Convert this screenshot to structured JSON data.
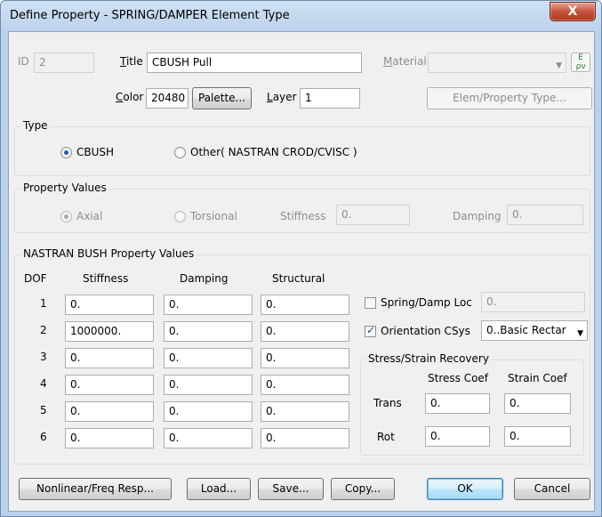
{
  "window": {
    "title": "Define Property - SPRING/DAMPER Element Type",
    "close_label": "X"
  },
  "header": {
    "id_label": "ID",
    "id_value": "2",
    "title_label": "Title",
    "title_value": "CBUSH Pull",
    "material_label": "Material",
    "material_value": "",
    "color_label": "Color",
    "color_value": "20480",
    "palette_label": "Palette...",
    "layer_label": "Layer",
    "layer_value": "1",
    "elem_prop_label": "Elem/Property Type..."
  },
  "type_group": {
    "title": "Type",
    "options": [
      {
        "label": "CBUSH",
        "checked": true
      },
      {
        "label": "Other( NASTRAN CROD/CVISC )",
        "checked": false
      }
    ]
  },
  "property_values": {
    "title": "Property Values",
    "axial_label": "Axial",
    "torsional_label": "Torsional",
    "stiffness_label": "Stiffness",
    "stiffness_value": "0.",
    "damping_label": "Damping",
    "damping_value": "0."
  },
  "bush": {
    "title": "NASTRAN BUSH Property Values",
    "headers": {
      "dof": "DOF",
      "stiffness": "Stiffness",
      "damping": "Damping",
      "structural": "Structural"
    },
    "rows": [
      {
        "dof": "1",
        "stiffness": "0.",
        "damping": "0.",
        "structural": "0."
      },
      {
        "dof": "2",
        "stiffness": "1000000.",
        "damping": "0.",
        "structural": "0."
      },
      {
        "dof": "3",
        "stiffness": "0.",
        "damping": "0.",
        "structural": "0."
      },
      {
        "dof": "4",
        "stiffness": "0.",
        "damping": "0.",
        "structural": "0."
      },
      {
        "dof": "5",
        "stiffness": "0.",
        "damping": "0.",
        "structural": "0."
      },
      {
        "dof": "6",
        "stiffness": "0.",
        "damping": "0.",
        "structural": "0."
      }
    ],
    "spring_damp_loc_label": "Spring/Damp Loc",
    "spring_damp_loc_checked": false,
    "spring_damp_loc_value": "0.",
    "orientation_label": "Orientation CSys",
    "orientation_checked": true,
    "orientation_value": "0..Basic Rectar",
    "recovery": {
      "title": "Stress/Strain Recovery",
      "stress_coef_label": "Stress Coef",
      "strain_coef_label": "Strain Coef",
      "trans_label": "Trans",
      "rot_label": "Rot",
      "trans_stress": "0.",
      "trans_strain": "0.",
      "rot_stress": "0.",
      "rot_strain": "0."
    }
  },
  "footer": {
    "nonlinear_label": "Nonlinear/Freq Resp...",
    "load_label": "Load...",
    "save_label": "Save...",
    "copy_label": "Copy...",
    "ok_label": "OK",
    "cancel_label": "Cancel"
  }
}
